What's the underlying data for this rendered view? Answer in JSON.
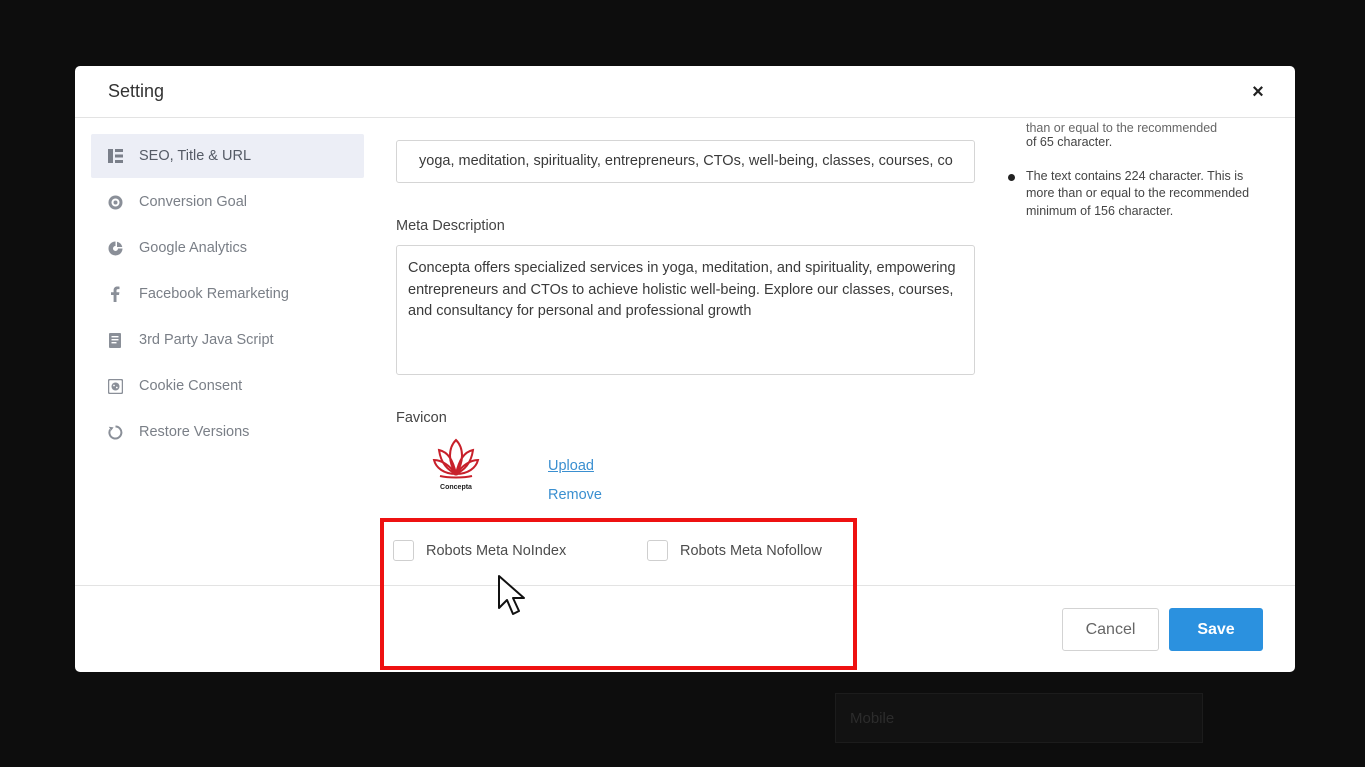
{
  "background": {
    "field_text": "Mobile"
  },
  "modal": {
    "title": "Setting",
    "close_symbol": "×"
  },
  "sidebar": {
    "items": [
      {
        "label": "SEO, Title & URL",
        "icon": "layout-list-icon",
        "active": true
      },
      {
        "label": "Conversion Goal",
        "icon": "target-icon",
        "active": false
      },
      {
        "label": "Google Analytics",
        "icon": "analytics-icon",
        "active": false
      },
      {
        "label": "Facebook Remarketing",
        "icon": "facebook-icon",
        "active": false
      },
      {
        "label": "3rd Party Java Script",
        "icon": "script-file-icon",
        "active": false
      },
      {
        "label": "Cookie Consent",
        "icon": "cookie-icon",
        "active": false
      },
      {
        "label": "Restore Versions",
        "icon": "restore-icon",
        "active": false
      }
    ]
  },
  "content": {
    "keywords_value": "yoga, meditation, spirituality, entrepreneurs, CTOs, well-being, classes, courses, co",
    "meta_description_label": "Meta Description",
    "meta_description_value": "Concepta offers specialized services in yoga, meditation, and spirituality, empowering entrepreneurs and CTOs to achieve holistic well-being. Explore our classes, courses, and consultancy for personal and professional growth",
    "favicon_label": "Favicon",
    "favicon_logo_text": "Concepta",
    "upload_label": "Upload",
    "remove_label": "Remove",
    "noindex_label": "Robots Meta NoIndex",
    "nofollow_label": "Robots Meta Nofollow"
  },
  "notes": {
    "cut_line": "than or equal to the recommended minimum",
    "title_note_end": "of 65 character.",
    "description_note": "The text contains 224 character. This is more than or equal to the recommended minimum of 156 character."
  },
  "footer": {
    "cancel_label": "Cancel",
    "save_label": "Save"
  },
  "colors": {
    "accent": "#2b91df",
    "highlight": "#ee1111",
    "logo": "#c8202a"
  }
}
